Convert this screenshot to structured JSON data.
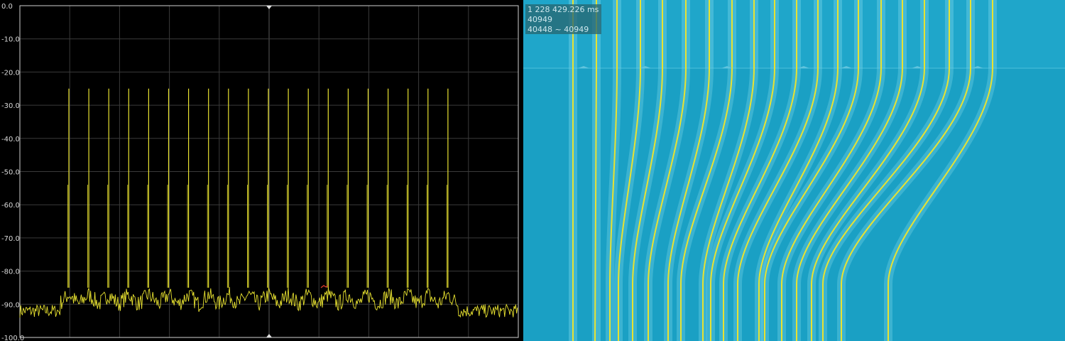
{
  "spectrum": {
    "y_axis_ticks": [
      "0.0",
      "-10.0",
      "-20.0",
      "-30.0",
      "-40.0",
      "-50.0",
      "-60.0",
      "-70.0",
      "-80.0",
      "-90.0",
      "-100.0"
    ],
    "colors": {
      "background": "#000000",
      "grid": "#3a3a3a",
      "trace": "#e8e230",
      "marker": "#d63a2a",
      "frame": "#cfcfcf"
    }
  },
  "waterfall": {
    "info": {
      "time": "1 228 429.226 ms",
      "line": "40949",
      "range": "40448 ~ 40949"
    },
    "colors": {
      "background": "#1aa0c4",
      "trace": "#e8e230",
      "halo": "#6fd0e6"
    }
  },
  "chart_data": {
    "type": "line",
    "title": "",
    "xlabel": "",
    "ylabel": "",
    "ylim": [
      -100,
      0
    ],
    "y_ticks": [
      0,
      -10,
      -20,
      -30,
      -40,
      -50,
      -60,
      -70,
      -80,
      -90,
      -100
    ],
    "grid": true,
    "series": [
      {
        "noise_floor_outer": -92,
        "noise_floor_band": -85,
        "peaks": [
          {
            "index": 1,
            "value": -25
          },
          {
            "index": 2,
            "value": -25
          },
          {
            "index": 3,
            "value": -25
          },
          {
            "index": 4,
            "value": -25
          },
          {
            "index": 5,
            "value": -25
          },
          {
            "index": 6,
            "value": -25
          },
          {
            "index": 7,
            "value": -25
          },
          {
            "index": 8,
            "value": -25
          },
          {
            "index": 9,
            "value": -25
          },
          {
            "index": 10,
            "value": -25
          },
          {
            "index": 11,
            "value": -25
          },
          {
            "index": 12,
            "value": -25
          },
          {
            "index": 13,
            "value": -25
          },
          {
            "index": 14,
            "value": -25
          },
          {
            "index": 15,
            "value": -25
          },
          {
            "index": 16,
            "value": -25
          },
          {
            "index": 17,
            "value": -25
          },
          {
            "index": 18,
            "value": -25
          },
          {
            "index": 19,
            "value": -25
          },
          {
            "index": 20,
            "value": -25
          }
        ],
        "shoulder": -54
      }
    ]
  }
}
